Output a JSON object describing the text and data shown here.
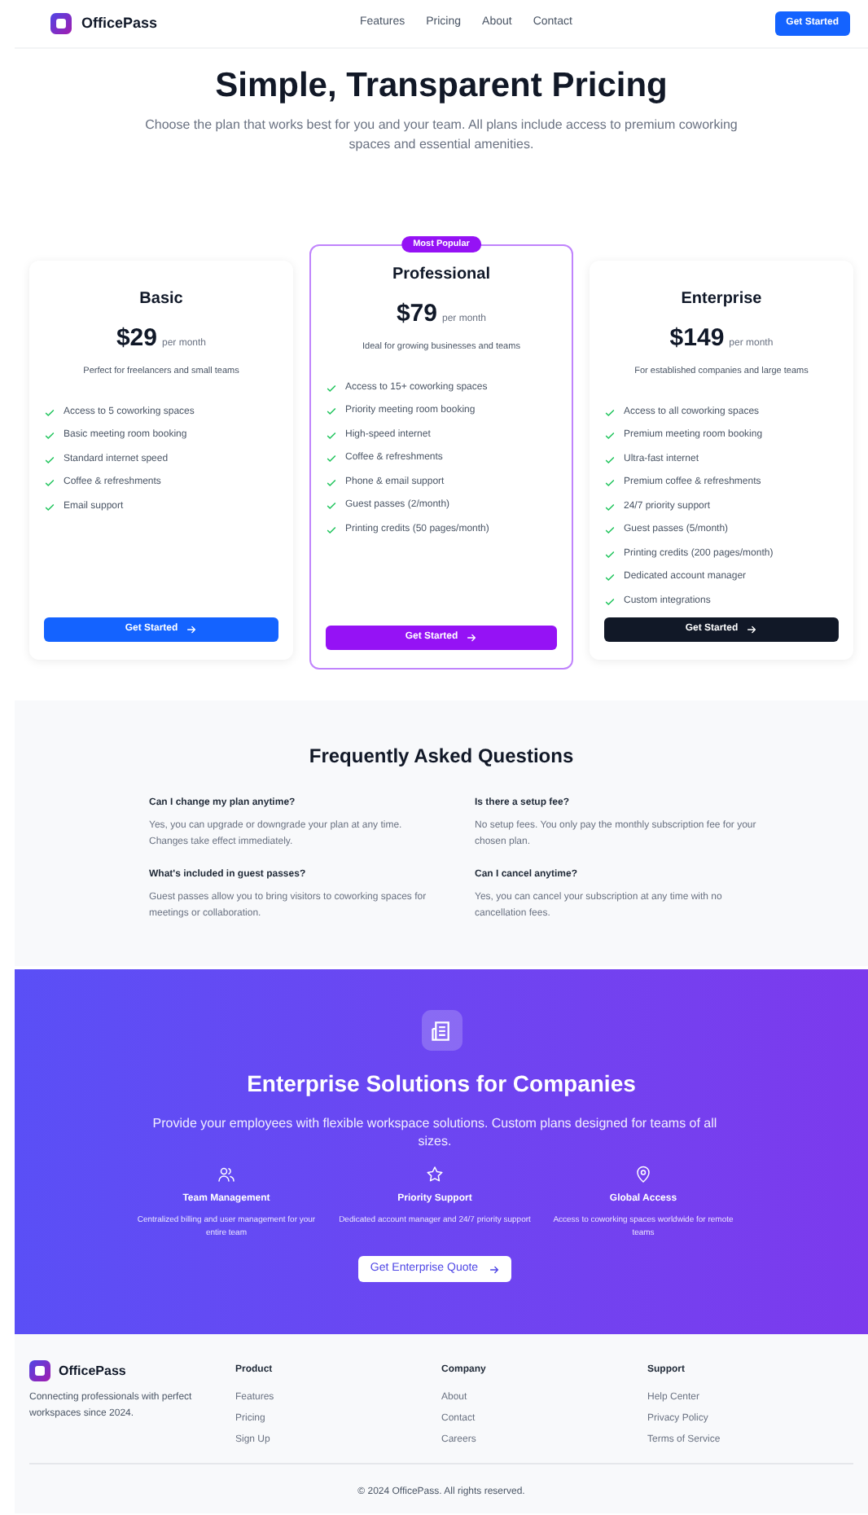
{
  "header": {
    "brand": "OfficePass",
    "nav": [
      "Features",
      "Pricing",
      "About",
      "Contact"
    ],
    "cta": "Get Started"
  },
  "hero": {
    "title": "Simple, Transparent Pricing",
    "subtitle": "Choose the plan that works best for you and your team. All plans include access to premium coworking spaces and essential amenities."
  },
  "plans": [
    {
      "name": "Basic",
      "price": "$29",
      "period": "per month",
      "description": "Perfect for freelancers and small teams",
      "popular": false,
      "color": "#1463ff",
      "features": [
        "Access to 5 coworking spaces",
        "Basic meeting room booking",
        "Standard internet speed",
        "Coffee & refreshments",
        "Email support"
      ],
      "button": "Get Started"
    },
    {
      "name": "Professional",
      "price": "$79",
      "period": "per month",
      "description": "Ideal for growing businesses and teams",
      "popular": true,
      "badge": "Most Popular",
      "color": "#9512f5",
      "features": [
        "Access to 15+ coworking spaces",
        "Priority meeting room booking",
        "High-speed internet",
        "Coffee & refreshments",
        "Phone & email support",
        "Guest passes (2/month)",
        "Printing credits (50 pages/month)"
      ],
      "button": "Get Started"
    },
    {
      "name": "Enterprise",
      "price": "$149",
      "period": "per month",
      "description": "For established companies and large teams",
      "popular": false,
      "color": "#111827",
      "features": [
        "Access to all coworking spaces",
        "Premium meeting room booking",
        "Ultra-fast internet",
        "Premium coffee & refreshments",
        "24/7 priority support",
        "Guest passes (5/month)",
        "Printing credits (200 pages/month)",
        "Dedicated account manager",
        "Custom integrations"
      ],
      "button": "Get Started"
    }
  ],
  "faq": {
    "title": "Frequently Asked Questions",
    "items": [
      {
        "question": "Can I change my plan anytime?",
        "answer": "Yes, you can upgrade or downgrade your plan at any time. Changes take effect immediately."
      },
      {
        "question": "Is there a setup fee?",
        "answer": "No setup fees. You only pay the monthly subscription fee for your chosen plan."
      },
      {
        "question": "What's included in guest passes?",
        "answer": "Guest passes allow you to bring visitors to coworking spaces for meetings or collaboration."
      },
      {
        "question": "Can I cancel anytime?",
        "answer": "Yes, you can cancel your subscription at any time with no cancellation fees."
      }
    ]
  },
  "enterprise": {
    "title": "Enterprise Solutions for Companies",
    "subtitle": "Provide your employees with flexible workspace solutions. Custom plans designed for teams of all sizes.",
    "features": [
      {
        "kind": "team",
        "title": "Team Management",
        "text": "Centralized billing and user management for your entire team"
      },
      {
        "kind": "star",
        "title": "Priority Support",
        "text": "Dedicated account manager and 24/7 priority support"
      },
      {
        "kind": "pin",
        "title": "Global Access",
        "text": "Access to coworking spaces worldwide for remote teams"
      }
    ],
    "button": "Get Enterprise Quote"
  },
  "footer": {
    "brand": "OfficePass",
    "tagline": "Connecting professionals with perfect workspaces since 2024.",
    "columns": [
      {
        "title": "Product",
        "links": [
          "Features",
          "Pricing",
          "Sign Up"
        ]
      },
      {
        "title": "Company",
        "links": [
          "About",
          "Contact",
          "Careers"
        ]
      },
      {
        "title": "Support",
        "links": [
          "Help Center",
          "Privacy Policy",
          "Terms of Service"
        ]
      }
    ],
    "copyright": "© 2024 OfficePass. All rights reserved."
  }
}
